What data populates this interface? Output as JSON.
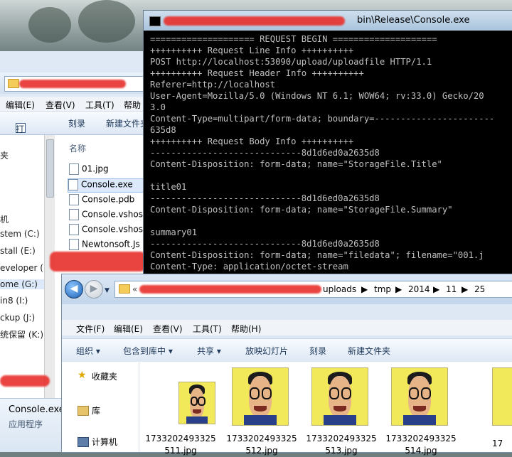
{
  "console": {
    "title": "bin\\Release\\Console.exe",
    "lines": [
      "==================== REQUEST BEGIN ====================",
      "++++++++++ Request Line Info ++++++++++",
      "POST http://localhost:53090/upload/uploadfile HTTP/1.1",
      "++++++++++ Request Header Info ++++++++++",
      "Referer=http://localhost",
      "User-Agent=Mozilla/5.0 (Windows NT 6.1; WOW64; rv:33.0) Gecko/20",
      "3.0",
      "Content-Type=multipart/form-data; boundary=-----------------------",
      "635d8",
      "++++++++++ Request Body Info ++++++++++",
      "-----------------------------8d1d6ed0a2635d8",
      "Content-Disposition: form-data; name=\"StorageFile.Title\"",
      "",
      "title01",
      "-----------------------------8d1d6ed0a2635d8",
      "Content-Disposition: form-data; name=\"StorageFile.Summary\"",
      "",
      "summary01",
      "-----------------------------8d1d6ed0a2635d8",
      "Content-Disposition: form-data; name=\"filedata\"; filename=\"001.j",
      "Content-Type: application/octet-stream"
    ]
  },
  "back_explorer": {
    "menu": {
      "edit": "编辑(E)",
      "view": "查看(V)",
      "tools": "工具(T)",
      "help": "帮助"
    },
    "toolbar": {
      "open": "打开",
      "burn": "刻录",
      "new_folder": "新建文件夹"
    },
    "nav_items": [
      "夹",
      "",
      "机",
      "stem (C:)",
      "stall (E:)",
      "eveloper (F",
      "ome (G:)",
      "in8 (I:)",
      "ckup (J:)",
      "统保留 (K:)"
    ],
    "column_name": "名称",
    "files": [
      "01.jpg",
      "Console.exe",
      "Console.pdb",
      "Console.vshos",
      "Console.vshos",
      "Newtonsoft.Js"
    ],
    "detail_name": "Console.exe",
    "detail_type": "应用程序"
  },
  "front_explorer": {
    "breadcrumb": [
      "uploads",
      "tmp",
      "2014",
      "11",
      "25"
    ],
    "menu": {
      "file": "文件(F)",
      "edit": "编辑(E)",
      "view": "查看(V)",
      "tools": "工具(T)",
      "help": "帮助(H)"
    },
    "toolbar": {
      "organize": "组织 ▾",
      "include": "包含到库中 ▾",
      "share": "共享 ▾",
      "slideshow": "放映幻灯片",
      "burn": "刻录",
      "new_folder": "新建文件夹"
    },
    "nav": {
      "favorites": "收藏夹",
      "libraries": "库",
      "computer": "计算机"
    },
    "files": [
      {
        "name1": "1733202493325",
        "name2": "511.jpg"
      },
      {
        "name1": "1733202493325",
        "name2": "512.jpg"
      },
      {
        "name1": "1733202493325",
        "name2": "513.jpg"
      },
      {
        "name1": "1733202493325",
        "name2": "514.jpg"
      }
    ],
    "cut_file_label": "17"
  }
}
